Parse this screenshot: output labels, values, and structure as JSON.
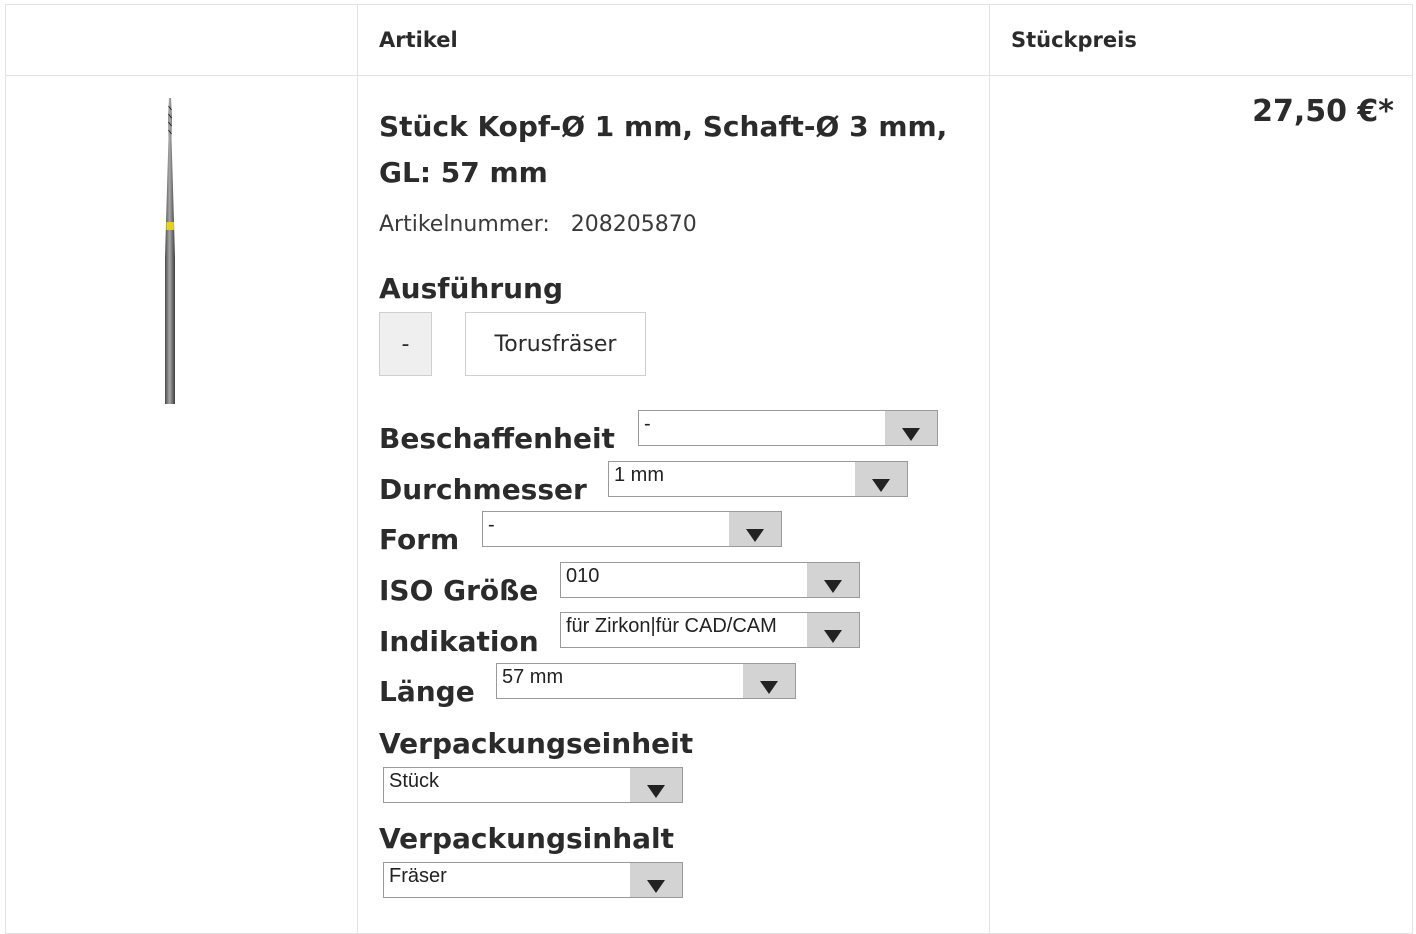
{
  "header": {
    "col_article": "Artikel",
    "col_unit_price": "Stückpreis"
  },
  "product": {
    "title": "Stück Kopf-Ø 1 mm, Schaft-Ø 3 mm, GL: 57 mm",
    "article_number_label": "Artikelnummer:",
    "article_number": "208205870",
    "price": "27,50 €*"
  },
  "ausfuehrung": {
    "label": "Ausführung",
    "options": [
      "-",
      "Torusfräser"
    ],
    "selected": "-"
  },
  "properties": {
    "beschaffenheit": {
      "label": "Beschaffenheit",
      "value": "-"
    },
    "durchmesser": {
      "label": "Durchmesser",
      "value": "1 mm"
    },
    "form": {
      "label": "Form",
      "value": "-"
    },
    "iso": {
      "label": "ISO Größe",
      "value": "010"
    },
    "indikation": {
      "label": "Indikation",
      "value": "für Zirkon|für CAD/CAM"
    },
    "laenge": {
      "label": "Länge",
      "value": "57 mm"
    },
    "verpackungseinheit": {
      "label": "Verpackungseinheit",
      "value": "Stück"
    },
    "verpackungsinhalt": {
      "label": "Verpackungsinhalt",
      "value": "Fräser"
    }
  },
  "colors": {
    "ring": "#e6d21a",
    "shaft": "#6f6f6f"
  }
}
